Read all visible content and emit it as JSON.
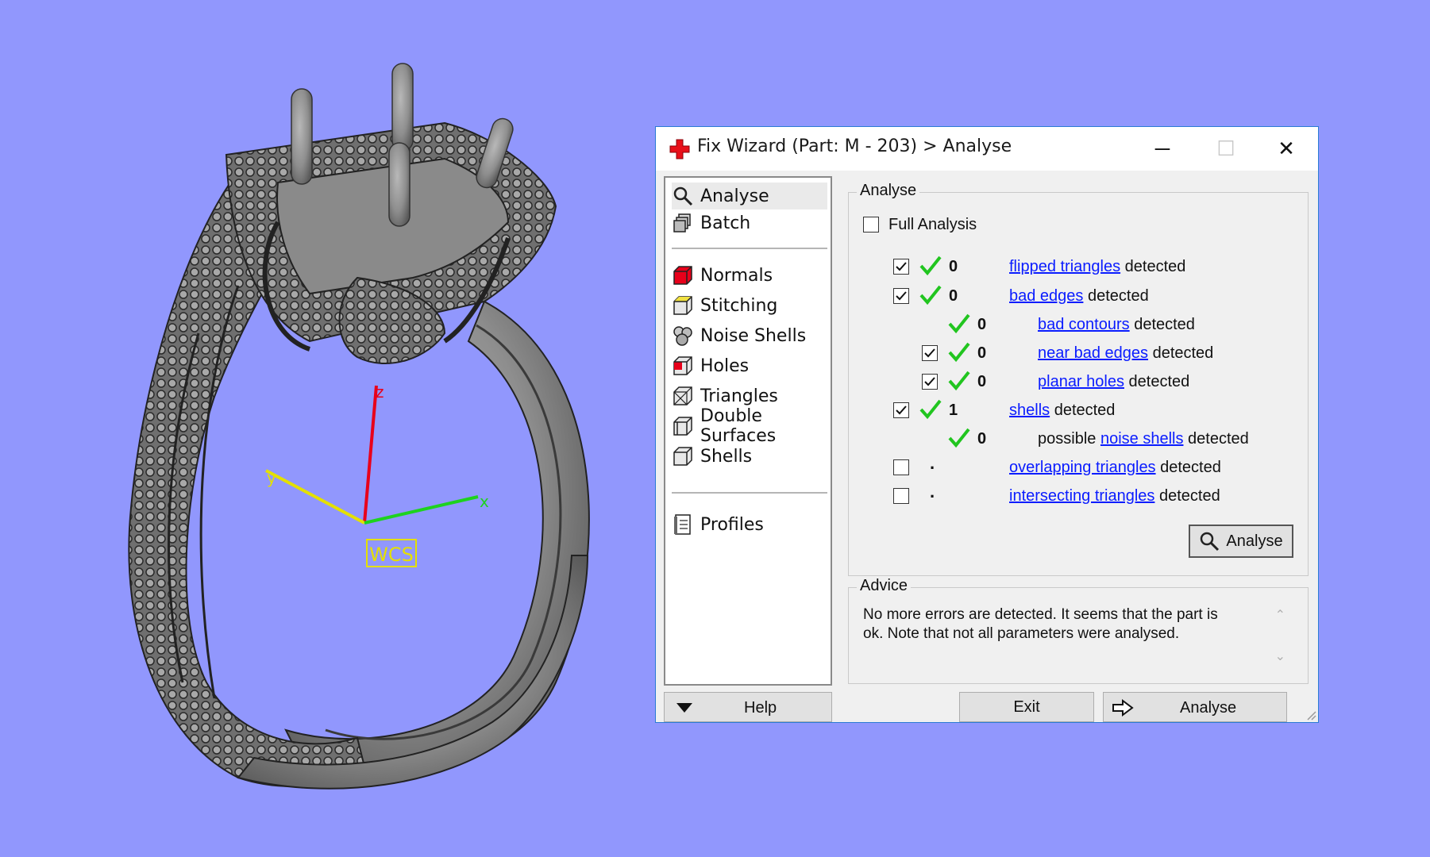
{
  "viewport": {
    "axis_x": "x",
    "axis_y": "y",
    "axis_z": "z",
    "wcs_label": "WCS"
  },
  "window": {
    "title": "Fix Wizard (Part: M - 203) > Analyse",
    "minimize_glyph": "─",
    "maximize_glyph": "☐",
    "close_glyph": "✕"
  },
  "nav": {
    "top": [
      {
        "label": "Analyse",
        "icon": "magnifier-icon"
      },
      {
        "label": "Batch",
        "icon": "batch-icon"
      }
    ],
    "tools": [
      {
        "label": "Normals",
        "icon": "normals-cube-icon"
      },
      {
        "label": "Stitching",
        "icon": "stitching-cube-icon"
      },
      {
        "label": "Noise Shells",
        "icon": "noise-shells-icon"
      },
      {
        "label": "Holes",
        "icon": "holes-cube-icon"
      },
      {
        "label": "Triangles",
        "icon": "triangles-cube-icon"
      },
      {
        "label": "Double Surfaces",
        "icon": "double-surfaces-icon"
      },
      {
        "label": "Shells",
        "icon": "shells-cube-icon"
      }
    ],
    "bottom": [
      {
        "label": "Profiles",
        "icon": "profiles-icon"
      }
    ]
  },
  "analyse": {
    "group_title": "Analyse",
    "full_analysis_label": "Full Analysis",
    "detected_word": "detected",
    "rows": [
      {
        "checked": true,
        "count": "0",
        "prefix": "",
        "link": "flipped triangles"
      },
      {
        "checked": true,
        "count": "0",
        "prefix": "",
        "link": "bad edges"
      },
      {
        "checked": null,
        "count": "0",
        "prefix": "",
        "link": "bad contours"
      },
      {
        "checked": true,
        "count": "0",
        "prefix": "",
        "link": "near bad edges"
      },
      {
        "checked": true,
        "count": "0",
        "prefix": "",
        "link": "planar holes"
      },
      {
        "checked": true,
        "count": "1",
        "prefix": "",
        "link": "shells"
      },
      {
        "checked": null,
        "count": "0",
        "prefix": "possible",
        "link": "noise shells"
      },
      {
        "checked": false,
        "count": ".",
        "prefix": "",
        "link": "overlapping triangles"
      },
      {
        "checked": false,
        "count": ".",
        "prefix": "",
        "link": "intersecting triangles"
      }
    ],
    "analyse_button": "Analyse"
  },
  "advice": {
    "group_title": "Advice",
    "text": "No more errors are detected. It seems that the part is ok. Note that not all parameters were analysed."
  },
  "footer": {
    "help_label": "Help",
    "exit_label": "Exit",
    "next_label": "Analyse"
  },
  "colors": {
    "background": "#9197fd",
    "axis_x": "#1ed21e",
    "axis_y": "#e4e000",
    "axis_z": "#e8001a",
    "link": "#0a1cff",
    "check_green": "#21c51f",
    "title_icon": "#e8101a"
  }
}
